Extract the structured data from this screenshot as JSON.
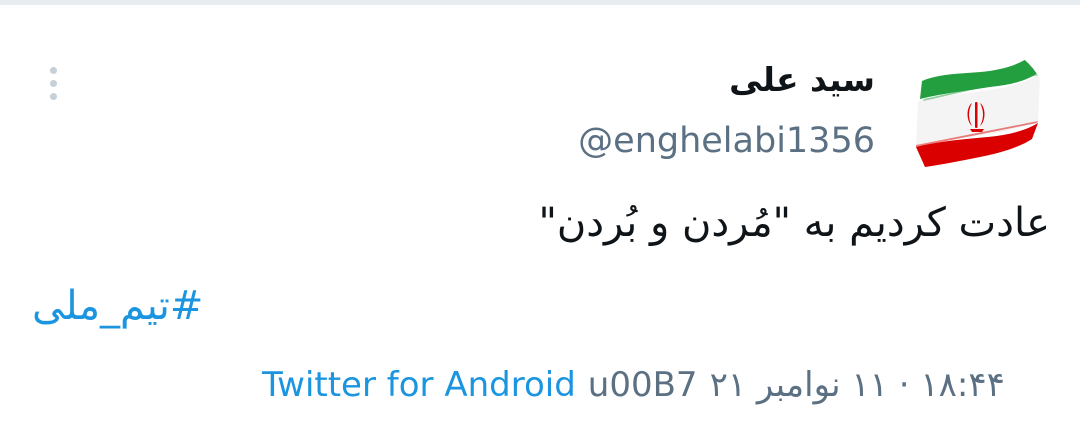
{
  "tweet": {
    "display_name": "سید علی",
    "username": "@enghelabi1356",
    "text": "عادت کردیم به \"مُردن و بُردن\"",
    "hashtag": "#تیم_ملی",
    "timestamp": "۱۸:۴۴ · ۱۱ نوامبر ۲۱",
    "separator": "u00B7",
    "source": "Twitter for Android"
  },
  "avatar": {
    "icon": "iran-flag-avatar",
    "colors": {
      "green": "#239f40",
      "white": "#ffffff",
      "red": "#da0000"
    }
  },
  "colors": {
    "link": "#1b95e0",
    "secondary_text": "#5b7083",
    "primary_text": "#0f1419",
    "divider": "#e6ecf0"
  }
}
